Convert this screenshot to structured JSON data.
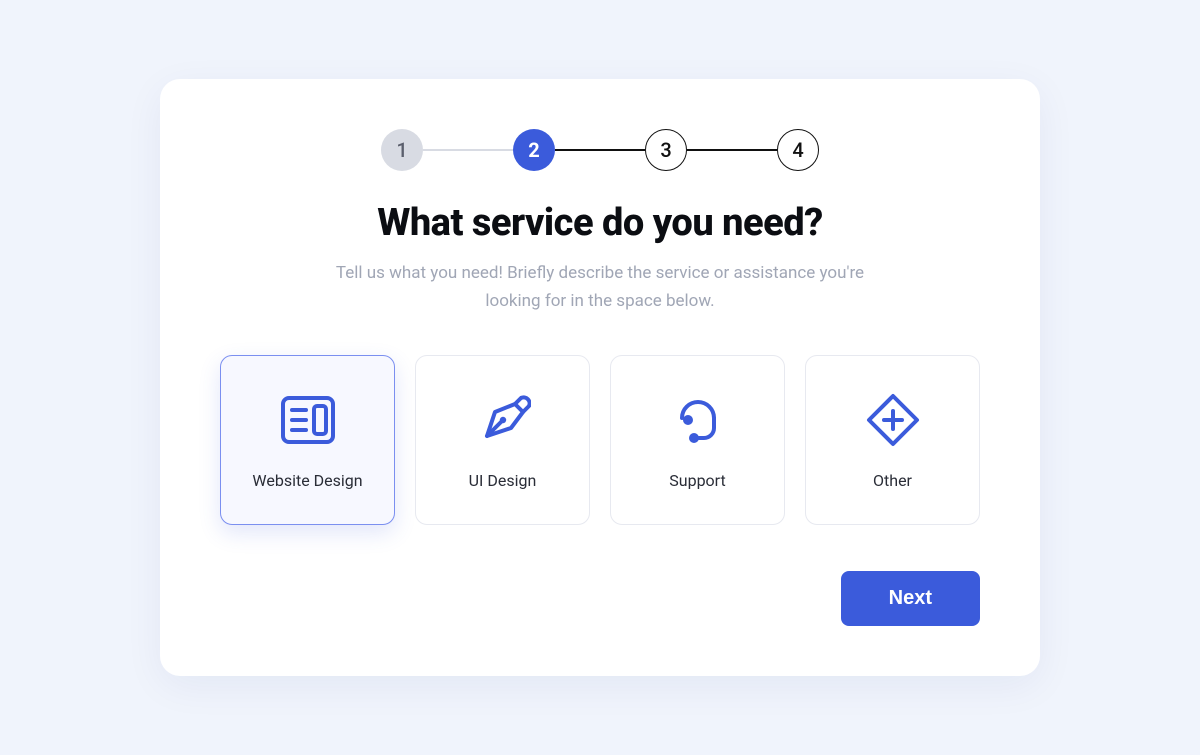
{
  "stepper": {
    "steps": [
      {
        "label": "1",
        "state": "past"
      },
      {
        "label": "2",
        "state": "active"
      },
      {
        "label": "3",
        "state": "future"
      },
      {
        "label": "4",
        "state": "future"
      }
    ]
  },
  "heading": "What service do you need?",
  "subtext": "Tell us what you need! Briefly describe the service or assistance you're looking for in the space below.",
  "options": [
    {
      "id": "website-design",
      "label": "Website Design",
      "icon": "layout-icon",
      "selected": true
    },
    {
      "id": "ui-design",
      "label": "UI Design",
      "icon": "pen-icon",
      "selected": false
    },
    {
      "id": "support",
      "label": "Support",
      "icon": "headset-icon",
      "selected": false
    },
    {
      "id": "other",
      "label": "Other",
      "icon": "diamond-plus-icon",
      "selected": false
    }
  ],
  "buttons": {
    "next": "Next"
  },
  "colors": {
    "accent": "#3b5bdb"
  }
}
